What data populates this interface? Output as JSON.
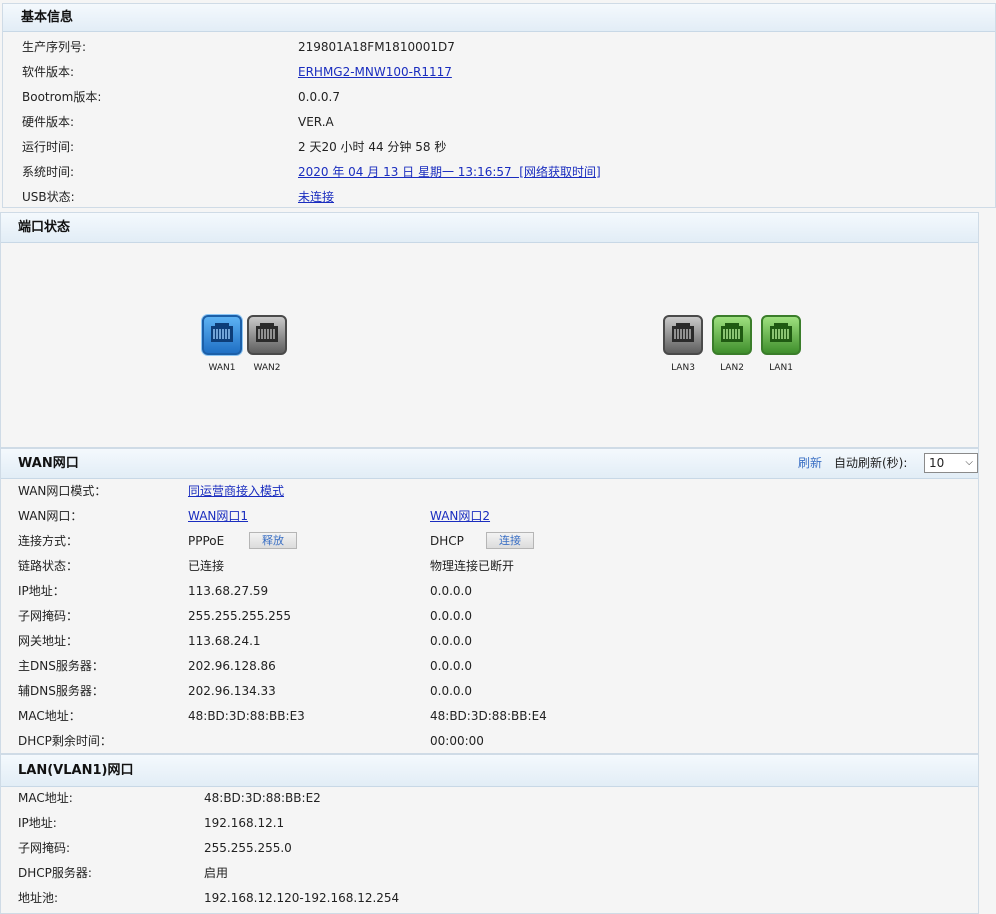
{
  "basic": {
    "title": "基本信息",
    "rows": [
      {
        "label": "生产序列号:",
        "value": "219801A18FM1810001D7",
        "link": false
      },
      {
        "label": "软件版本:",
        "value": "ERHMG2-MNW100-R1117",
        "link": true
      },
      {
        "label": "Bootrom版本:",
        "value": "0.0.0.7",
        "link": false
      },
      {
        "label": "硬件版本:",
        "value": "VER.A",
        "link": false
      },
      {
        "label": "运行时间:",
        "value": "2 天20 小时 44 分钟 58 秒",
        "link": false
      },
      {
        "label": "系统时间:",
        "value": "2020 年 04 月 13 日 星期一 13:16:57  [网络获取时间]",
        "link": true
      },
      {
        "label": "USB状态:",
        "value": "未连接",
        "link": true
      }
    ]
  },
  "ports": {
    "title": "端口状态",
    "items": [
      {
        "name": "WAN1",
        "state": "active",
        "color": "#2b86d6"
      },
      {
        "name": "WAN2",
        "state": "disconnected",
        "color": "#6e6e6e"
      },
      {
        "name": "LAN3",
        "state": "disconnected",
        "color": "#6e6e6e"
      },
      {
        "name": "LAN2",
        "state": "connected",
        "color": "#4fa83a"
      },
      {
        "name": "LAN1",
        "state": "connected",
        "color": "#4fa83a"
      }
    ]
  },
  "wan": {
    "title": "WAN网口",
    "refresh_label": "刷新",
    "auto_refresh_label": "自动刷新(秒):",
    "auto_refresh_value": "10",
    "mode_label": "WAN网口模式：",
    "mode_value": "同运营商接入模式",
    "port_label": "WAN网口：",
    "port1": "WAN网口1",
    "port2": "WAN网口2",
    "conn_label": "连接方式：",
    "conn1": "PPPoE",
    "conn1_button": "释放",
    "conn2": "DHCP",
    "conn2_button": "连接",
    "rows": [
      {
        "label": "链路状态：",
        "v1": "已连接",
        "v2": "物理连接已断开"
      },
      {
        "label": "IP地址：",
        "v1": "113.68.27.59",
        "v2": "0.0.0.0"
      },
      {
        "label": "子网掩码：",
        "v1": "255.255.255.255",
        "v2": "0.0.0.0"
      },
      {
        "label": "网关地址：",
        "v1": "113.68.24.1",
        "v2": "0.0.0.0"
      },
      {
        "label": "主DNS服务器：",
        "v1": "202.96.128.86",
        "v2": "0.0.0.0"
      },
      {
        "label": "辅DNS服务器：",
        "v1": "202.96.134.33",
        "v2": "0.0.0.0"
      },
      {
        "label": "MAC地址：",
        "v1": "48:BD:3D:88:BB:E3",
        "v2": "48:BD:3D:88:BB:E4"
      },
      {
        "label": "DHCP剩余时间：",
        "v1": "",
        "v2": "00:00:00"
      }
    ]
  },
  "lan": {
    "title": "LAN(VLAN1)网口",
    "rows": [
      {
        "label": "MAC地址:",
        "value": "48:BD:3D:88:BB:E2"
      },
      {
        "label": "IP地址:",
        "value": "192.168.12.1"
      },
      {
        "label": "子网掩码:",
        "value": "255.255.255.0"
      },
      {
        "label": "DHCP服务器:",
        "value": "启用"
      },
      {
        "label": "地址池:",
        "value": "192.168.12.120-192.168.12.254"
      }
    ]
  }
}
